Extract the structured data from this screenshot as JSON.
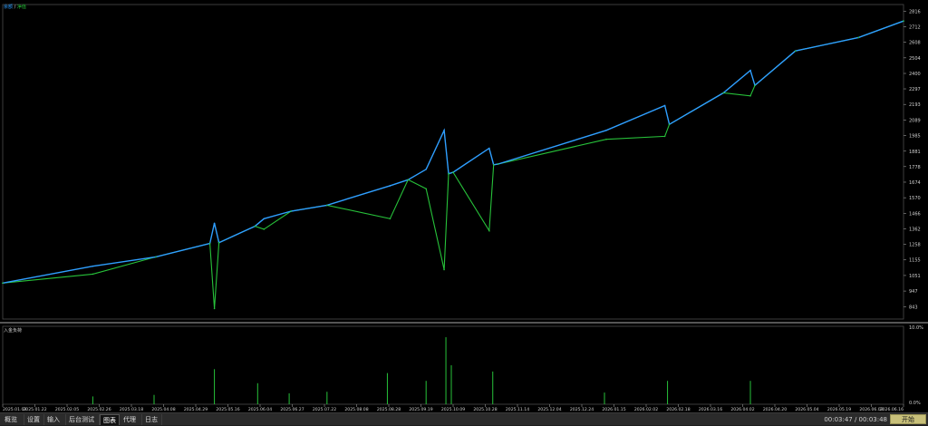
{
  "legend": {
    "balance_label": "余额",
    "separator": "/",
    "equity_label": "净值",
    "balance_color": "#2f9fff",
    "equity_color": "#27c23a"
  },
  "deposit_load": {
    "title": "入金负荷",
    "bar_color": "#27c23a"
  },
  "chart_data": {
    "type": "line",
    "title": "",
    "xlabel": "",
    "ylabel": "",
    "ylim": [
      760,
      2860
    ],
    "yticks": [
      843,
      947,
      1051,
      1155,
      1258,
      1362,
      1466,
      1570,
      1674,
      1778,
      1881,
      1985,
      2089,
      2193,
      2297,
      2400,
      2504,
      2608,
      2712,
      2816
    ],
    "x_tick_labels": [
      "2025.01.03",
      "2025.01.22",
      "2025.02.05",
      "2025.02.26",
      "2025.03.18",
      "2025.04.08",
      "2025.04.29",
      "2025.05.16",
      "2025.06.04",
      "2025.06.27",
      "2025.07.22",
      "2025.08.08",
      "2025.08.28",
      "2025.09.19",
      "2025.10.09",
      "2025.10.28",
      "2025.11.14",
      "2025.12.04",
      "2025.12.24",
      "2026.01.15",
      "2026.02.02",
      "2026.02.18",
      "2026.03.16",
      "2026.04.02",
      "2026.04.20",
      "2026.05.04",
      "2026.05.19",
      "2026.06.03",
      "2026.06.16"
    ],
    "x": [
      0.0,
      0.1,
      0.17,
      0.23,
      0.235,
      0.24,
      0.28,
      0.29,
      0.32,
      0.36,
      0.43,
      0.45,
      0.47,
      0.49,
      0.495,
      0.5,
      0.54,
      0.545,
      0.55,
      0.67,
      0.735,
      0.74,
      0.8,
      0.83,
      0.835,
      0.88,
      0.95,
      1.0
    ],
    "series": [
      {
        "name": "余额",
        "values": [
          1000,
          1113,
          1175,
          1265,
          1400,
          1270,
          1380,
          1430,
          1480,
          1520,
          1650,
          1690,
          1760,
          2020,
          1730,
          1740,
          1900,
          1790,
          1795,
          2020,
          2185,
          2060,
          2270,
          2420,
          2320,
          2550,
          2640,
          2750
        ]
      },
      {
        "name": "净值",
        "values": [
          1000,
          1060,
          1175,
          1265,
          830,
          1270,
          1380,
          1360,
          1480,
          1520,
          1430,
          1690,
          1630,
          1090,
          1730,
          1740,
          1350,
          1790,
          1795,
          1960,
          1980,
          2060,
          2270,
          2250,
          2320,
          2550,
          2640,
          2750
        ]
      }
    ],
    "load_panel": {
      "ylim": [
        0,
        10
      ],
      "yticks_labels": [
        "10.0%",
        "0.0%"
      ],
      "spikes": [
        {
          "x": 0.1,
          "value": 1.0
        },
        {
          "x": 0.168,
          "value": 1.2
        },
        {
          "x": 0.235,
          "value": 4.5
        },
        {
          "x": 0.283,
          "value": 2.7
        },
        {
          "x": 0.318,
          "value": 1.4
        },
        {
          "x": 0.36,
          "value": 1.6
        },
        {
          "x": 0.427,
          "value": 4.0
        },
        {
          "x": 0.47,
          "value": 3.0
        },
        {
          "x": 0.492,
          "value": 8.6
        },
        {
          "x": 0.498,
          "value": 5.0
        },
        {
          "x": 0.544,
          "value": 4.2
        },
        {
          "x": 0.668,
          "value": 1.5
        },
        {
          "x": 0.738,
          "value": 3.0
        },
        {
          "x": 0.83,
          "value": 3.0
        }
      ]
    }
  },
  "bottom_tabs": [
    "概览",
    "设置",
    "输入",
    "后台测试",
    "图表",
    "代理",
    "日志"
  ],
  "active_tab_index": 4,
  "timer": "00:03:47 / 00:03:48",
  "start_button": "开始"
}
